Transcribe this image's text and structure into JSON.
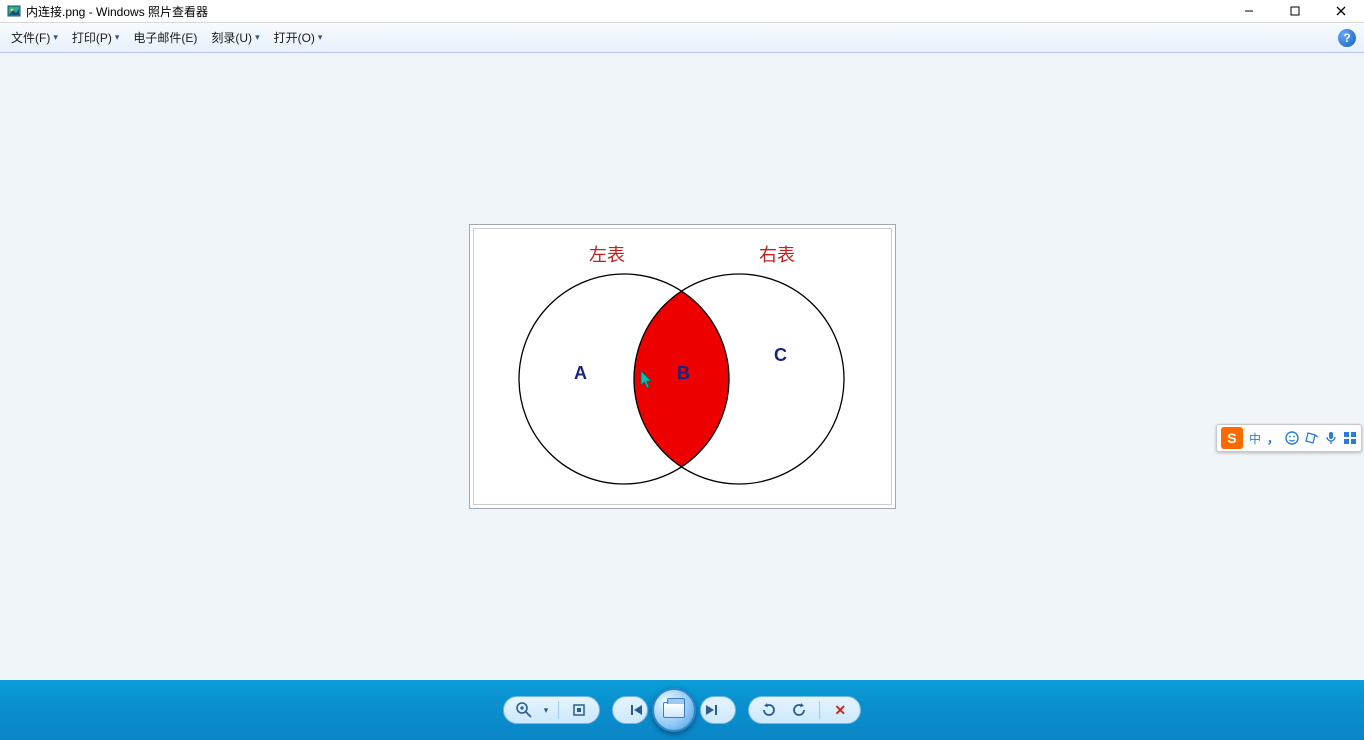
{
  "window": {
    "title": "内连接.png - Windows 照片查看器"
  },
  "menu": {
    "items": [
      {
        "label": "文件(F)"
      },
      {
        "label": "打印(P)"
      },
      {
        "label": "电子邮件(E)"
      },
      {
        "label": "刻录(U)"
      },
      {
        "label": "打开(O)"
      }
    ]
  },
  "image": {
    "left_title": "左表",
    "right_title": "右表",
    "label_a": "A",
    "label_b": "B",
    "label_c": "C",
    "colors": {
      "intersection": "#ef0000",
      "title_color": "#c21e1e",
      "label_color": "#1a237e"
    }
  },
  "toolbar": {
    "zoom": "zoom",
    "fit": "fit",
    "prev": "prev",
    "play": "play",
    "next": "next",
    "rotate_ccw": "rotate-ccw",
    "rotate_cw": "rotate-cw",
    "delete": "delete"
  },
  "ime": {
    "lang": "中",
    "punct": "，",
    "items": [
      "emoji",
      "note",
      "mic",
      "grid"
    ]
  }
}
